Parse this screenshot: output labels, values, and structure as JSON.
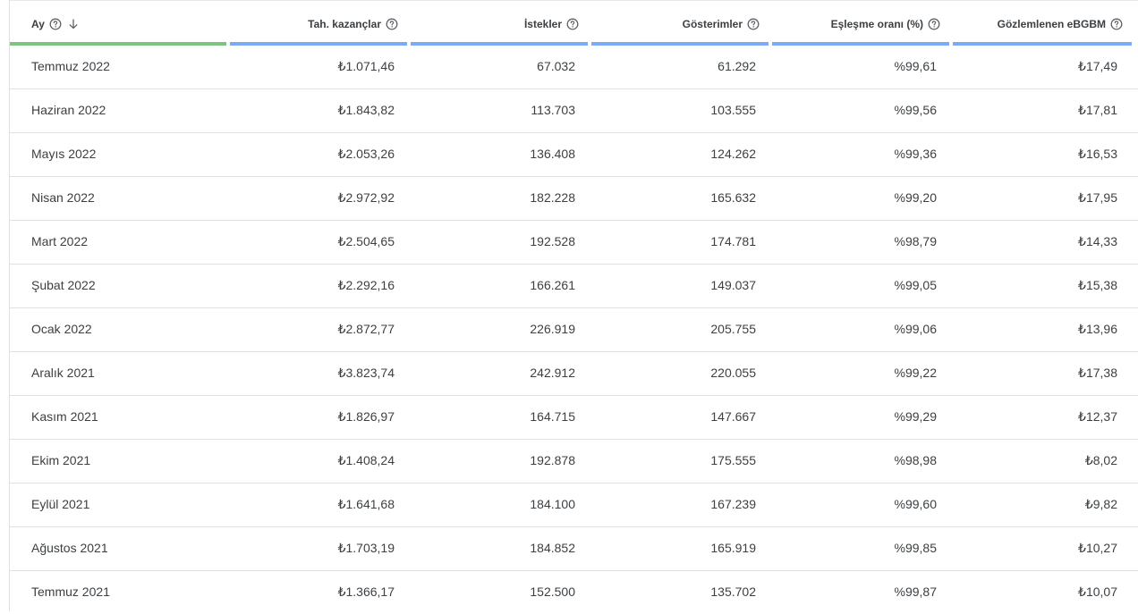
{
  "table": {
    "columns": [
      {
        "key": "month",
        "label": "Ay",
        "sorted": true
      },
      {
        "key": "earnings",
        "label": "Tah. kazançlar",
        "sorted": false
      },
      {
        "key": "requests",
        "label": "İstekler",
        "sorted": false
      },
      {
        "key": "impressions",
        "label": "Gösterimler",
        "sorted": false
      },
      {
        "key": "match_rate",
        "label": "Eşleşme oranı (%)",
        "sorted": false
      },
      {
        "key": "ecpm",
        "label": "Gözlemlenen eBGBM",
        "sorted": false
      }
    ],
    "rows": [
      [
        "Temmuz 2022",
        "₺1.071,46",
        "67.032",
        "61.292",
        "%99,61",
        "₺17,49"
      ],
      [
        "Haziran 2022",
        "₺1.843,82",
        "113.703",
        "103.555",
        "%99,56",
        "₺17,81"
      ],
      [
        "Mayıs 2022",
        "₺2.053,26",
        "136.408",
        "124.262",
        "%99,36",
        "₺16,53"
      ],
      [
        "Nisan 2022",
        "₺2.972,92",
        "182.228",
        "165.632",
        "%99,20",
        "₺17,95"
      ],
      [
        "Mart 2022",
        "₺2.504,65",
        "192.528",
        "174.781",
        "%98,79",
        "₺14,33"
      ],
      [
        "Şubat 2022",
        "₺2.292,16",
        "166.261",
        "149.037",
        "%99,05",
        "₺15,38"
      ],
      [
        "Ocak 2022",
        "₺2.872,77",
        "226.919",
        "205.755",
        "%99,06",
        "₺13,96"
      ],
      [
        "Aralık 2021",
        "₺3.823,74",
        "242.912",
        "220.055",
        "%99,22",
        "₺17,38"
      ],
      [
        "Kasım 2021",
        "₺1.826,97",
        "164.715",
        "147.667",
        "%99,29",
        "₺12,37"
      ],
      [
        "Ekim 2021",
        "₺1.408,24",
        "192.878",
        "175.555",
        "%98,98",
        "₺8,02"
      ],
      [
        "Eylül 2021",
        "₺1.641,68",
        "184.100",
        "167.239",
        "%99,60",
        "₺9,82"
      ],
      [
        "Ağustos 2021",
        "₺1.703,19",
        "184.852",
        "165.919",
        "%99,85",
        "₺10,27"
      ],
      [
        "Temmuz 2021",
        "₺1.366,17",
        "152.500",
        "135.702",
        "%99,87",
        "₺10,07"
      ]
    ]
  },
  "colors": {
    "sorted_bar": "#7cc47f",
    "column_bar": "#7baaf7",
    "text": "#3c4043",
    "divider": "#e0e0e0"
  },
  "icons": {
    "help": "help-circle-icon",
    "sort": "arrow-down-icon"
  }
}
